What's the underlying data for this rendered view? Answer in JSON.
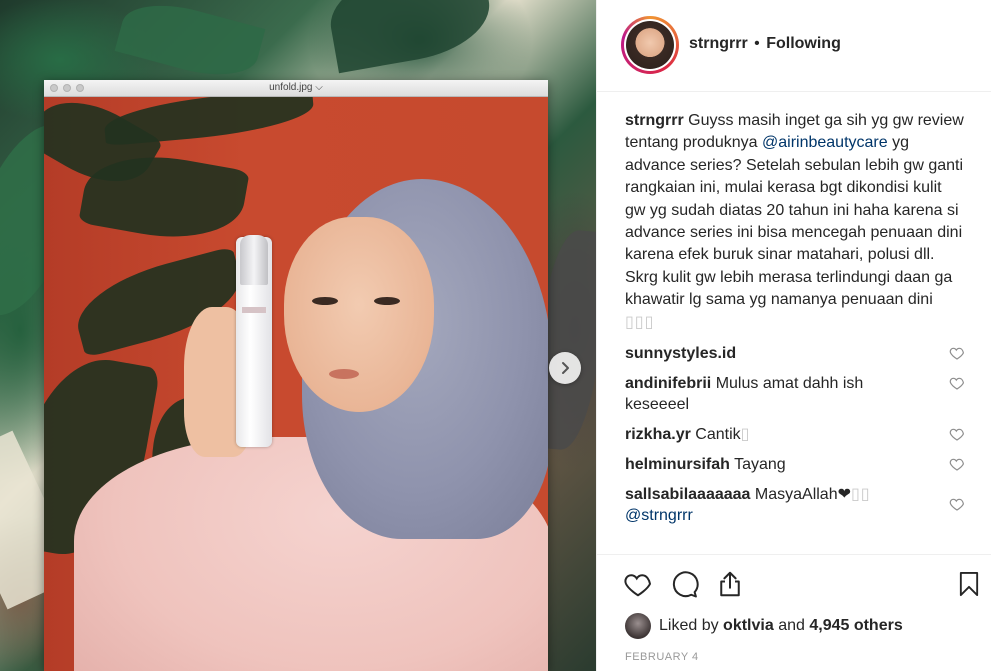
{
  "photo": {
    "window_title": "unfold.jpg ⌵"
  },
  "post": {
    "username": "strngrrr",
    "separator": "•",
    "follow_status": "Following",
    "caption": {
      "author": "strngrrr",
      "text_before_mention": "Guyss masih inget ga sih yg gw review tentang produknya",
      "mention": "@airinbeautycare",
      "text_after_mention": "yg advance series? Setelah sebulan lebih gw ganti rangkaian ini, mulai kerasa bgt dikondisi kulit gw yg sudah diatas 20 tahun ini haha karena si advance series ini bisa mencegah penuaan dini karena efek buruk sinar matahari, polusi dll. Skrg kulit gw lebih merasa terlindungi daan ga khawatir lg sama yg namanya penuaan dini",
      "trailing_glyphs": "▯▯▯"
    },
    "comments": [
      {
        "user": "sunnystyles.id",
        "text": "",
        "glyphs": ""
      },
      {
        "user": "andinifebrii",
        "text": "Mulus amat dahh ish keseeeel",
        "glyphs": ""
      },
      {
        "user": "rizkha.yr",
        "text": "Cantik",
        "glyphs": "▯"
      },
      {
        "user": "helminursifah",
        "text": "Tayang",
        "glyphs": ""
      },
      {
        "user": "sallsabilaaaaaaa",
        "text": "MasyaAllah❤",
        "glyphs": "▯▯",
        "mention": "@strngrrr"
      }
    ],
    "likes": {
      "prefix": "Liked by",
      "user": "oktlvia",
      "middle": "and",
      "count": "4,945 others"
    },
    "date": "FEBRUARY 4"
  },
  "icons": {
    "like": "heart-icon",
    "comment": "comment-bubble-icon",
    "share": "share-icon",
    "save": "bookmark-icon",
    "next": "chevron-right-icon"
  }
}
